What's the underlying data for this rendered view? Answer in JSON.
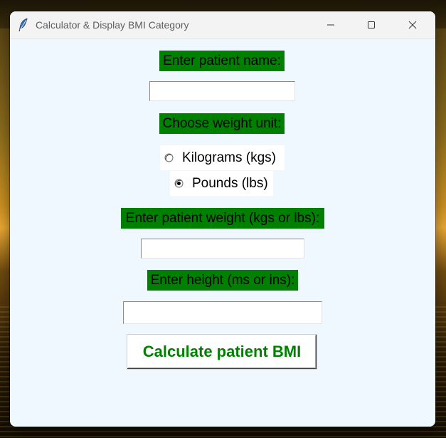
{
  "window": {
    "title": "Calculator & Display BMI Category",
    "app_icon": "feather-icon",
    "controls": [
      "minimize-icon",
      "maximize-icon",
      "close-icon"
    ]
  },
  "form": {
    "name_label": "Enter patient name:",
    "name_value": "",
    "unit_label": "Choose weight unit:",
    "unit_options": [
      {
        "label": "Kilograms (kgs)",
        "selected": false
      },
      {
        "label": "Pounds (lbs)",
        "selected": true
      }
    ],
    "weight_label": "Enter patient weight (kgs or lbs):",
    "weight_value": "",
    "height_label": "Enter height (ms or ins):",
    "height_value": "",
    "calculate_button": "Calculate patient BMI"
  },
  "colors": {
    "background": "#f0f8ff",
    "label_bg": "#008000",
    "button_text": "#008000"
  }
}
